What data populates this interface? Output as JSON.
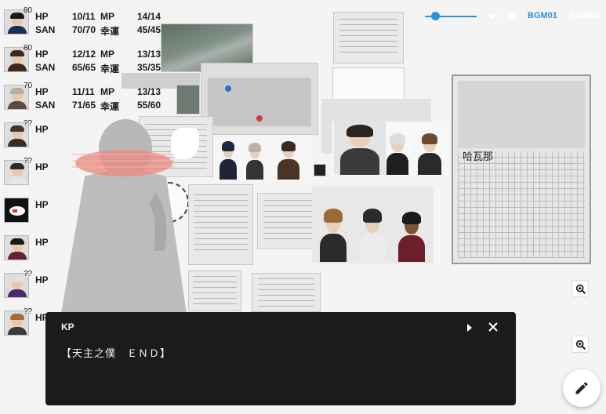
{
  "characters": [
    {
      "badge": "80",
      "hp_label": "HP",
      "hp": "10/11",
      "mp_label": "MP",
      "mp": "14/14",
      "san_label": "SAN",
      "san": "70/70",
      "luck_label": "幸運",
      "luck": "45/45"
    },
    {
      "badge": "80",
      "hp_label": "HP",
      "hp": "12/12",
      "mp_label": "MP",
      "mp": "13/13",
      "san_label": "SAN",
      "san": "65/65",
      "luck_label": "幸運",
      "luck": "35/35"
    },
    {
      "badge": "70",
      "hp_label": "HP",
      "hp": "11/11",
      "mp_label": "MP",
      "mp": "13/13",
      "san_label": "SAN",
      "san": "71/65",
      "luck_label": "幸運",
      "luck": "55/60"
    },
    {
      "badge": "??",
      "hp_label": "HP"
    },
    {
      "badge": "??",
      "hp_label": "HP"
    },
    {
      "badge": "",
      "hp_label": "HP"
    },
    {
      "badge": "",
      "hp_label": "HP"
    },
    {
      "badge": "??",
      "hp_label": "HP"
    },
    {
      "badge": "??",
      "hp_label": "HP"
    }
  ],
  "audio": {
    "volume": 0.2,
    "tabs": [
      "BGM01",
      "BGM02"
    ],
    "active_tab": "BGM01",
    "accent": "#2f8fdc"
  },
  "scene": {
    "map_label": "哈瓦那"
  },
  "message": {
    "speaker": "KP",
    "text": "【天主之僕　ＥＮＤ】"
  },
  "icons": {
    "zoom": "zoom-in-icon",
    "next": "play-arrow-icon",
    "close": "close-icon",
    "edit": "pencil-icon",
    "mute": "volume-off-icon"
  }
}
